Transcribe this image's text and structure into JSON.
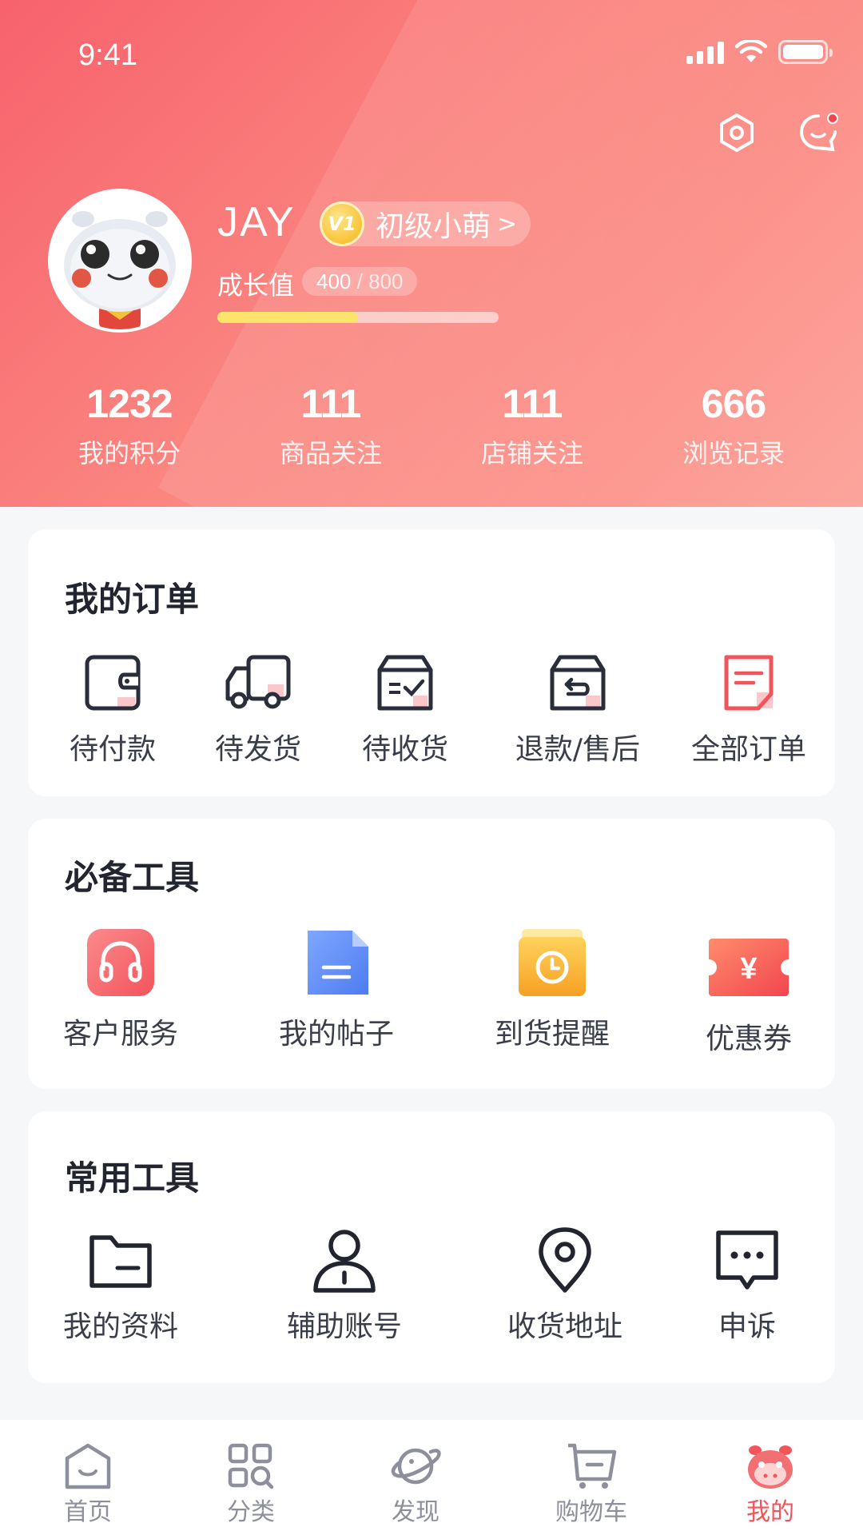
{
  "status_bar": {
    "time": "9:41"
  },
  "header": {
    "username": "JAY",
    "level_icon_text": "V1",
    "level_name": "初级小萌",
    "level_arrow": ">",
    "growth_label": "成长值",
    "growth_current": "400",
    "growth_separator": " / ",
    "growth_max": "800",
    "growth_progress": 0.5
  },
  "stats": [
    {
      "value": "1232",
      "label": "我的积分"
    },
    {
      "value": "111",
      "label": "商品关注"
    },
    {
      "value": "111",
      "label": "店铺关注"
    },
    {
      "value": "666",
      "label": "浏览记录"
    }
  ],
  "orders": {
    "title": "我的订单",
    "items": [
      {
        "label": "待付款",
        "icon": "wallet-icon"
      },
      {
        "label": "待发货",
        "icon": "truck-icon"
      },
      {
        "label": "待收货",
        "icon": "box-check-icon"
      },
      {
        "label": "退款/售后",
        "icon": "box-return-icon"
      },
      {
        "label": "全部订单",
        "icon": "document-icon"
      }
    ]
  },
  "essential_tools": {
    "title": "必备工具",
    "items": [
      {
        "label": "客户服务",
        "icon": "headphones-icon"
      },
      {
        "label": "我的帖子",
        "icon": "post-icon"
      },
      {
        "label": "到货提醒",
        "icon": "clock-icon"
      },
      {
        "label": "优惠券",
        "icon": "coupon-icon",
        "symbol": "¥"
      }
    ]
  },
  "common_tools": {
    "title": "常用工具",
    "items": [
      {
        "label": "我的资料",
        "icon": "folder-icon"
      },
      {
        "label": "辅助账号",
        "icon": "user-icon"
      },
      {
        "label": "收货地址",
        "icon": "location-icon"
      },
      {
        "label": "申诉",
        "icon": "chat-icon"
      }
    ]
  },
  "tabbar": {
    "items": [
      {
        "label": "首页",
        "icon": "home-icon",
        "active": false
      },
      {
        "label": "分类",
        "icon": "category-icon",
        "active": false
      },
      {
        "label": "发现",
        "icon": "planet-icon",
        "active": false
      },
      {
        "label": "购物车",
        "icon": "cart-icon",
        "active": false
      },
      {
        "label": "我的",
        "icon": "mascot-icon",
        "active": true
      }
    ]
  },
  "colors": {
    "accent": "#f2545b",
    "header_start": "#f7626c",
    "header_end": "#fca59c",
    "progress": "#fce36a"
  }
}
